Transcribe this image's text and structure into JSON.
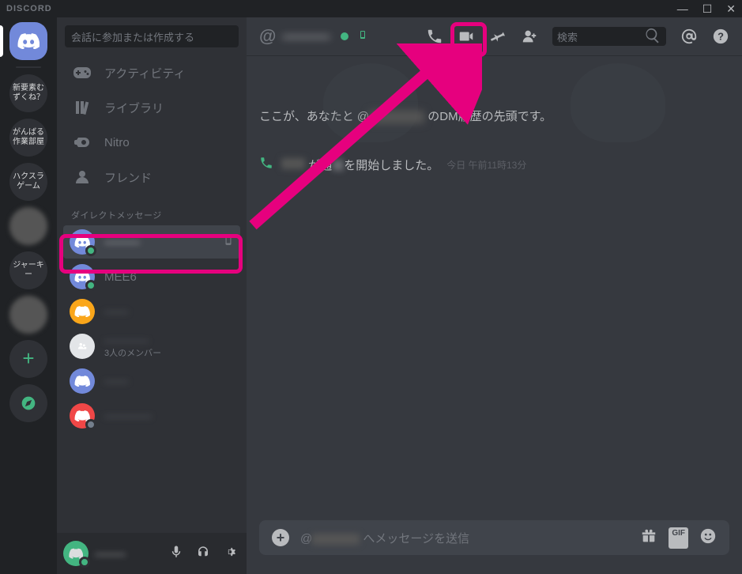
{
  "titlebar": {
    "logo": "DISCORD"
  },
  "servers": {
    "items": [
      "新要素むずくね？",
      "がんばる作業部屋",
      "ハクスラゲーム",
      "",
      "ジャーキー",
      ""
    ]
  },
  "sidebar": {
    "search_placeholder": "会話に参加または作成する",
    "nav": {
      "activity": "アクティビティ",
      "library": "ライブラリ",
      "nitro": "Nitro",
      "friends": "フレンド"
    },
    "dm_header": "ダイレクトメッセージ",
    "dm_items": [
      {
        "name": "———"
      },
      {
        "name": "MEE6"
      },
      {
        "name": "——"
      },
      {
        "name": "————",
        "sub": "3人のメンバー"
      },
      {
        "name": "——"
      },
      {
        "name": "————"
      }
    ]
  },
  "user_panel": {
    "name": "———"
  },
  "chat": {
    "header": {
      "title": "————",
      "search_placeholder": "検索"
    },
    "dm_start_before": "ここが、あなたと",
    "dm_start_after": "のDM履歴の先頭です。",
    "call_text_before": "が通",
    "call_text_after": "を開始しました。",
    "call_timestamp": "今日 午前11時13分",
    "input_prefix": "@",
    "input_suffix": "へメッセージを送信",
    "gif_label": "GIF"
  }
}
